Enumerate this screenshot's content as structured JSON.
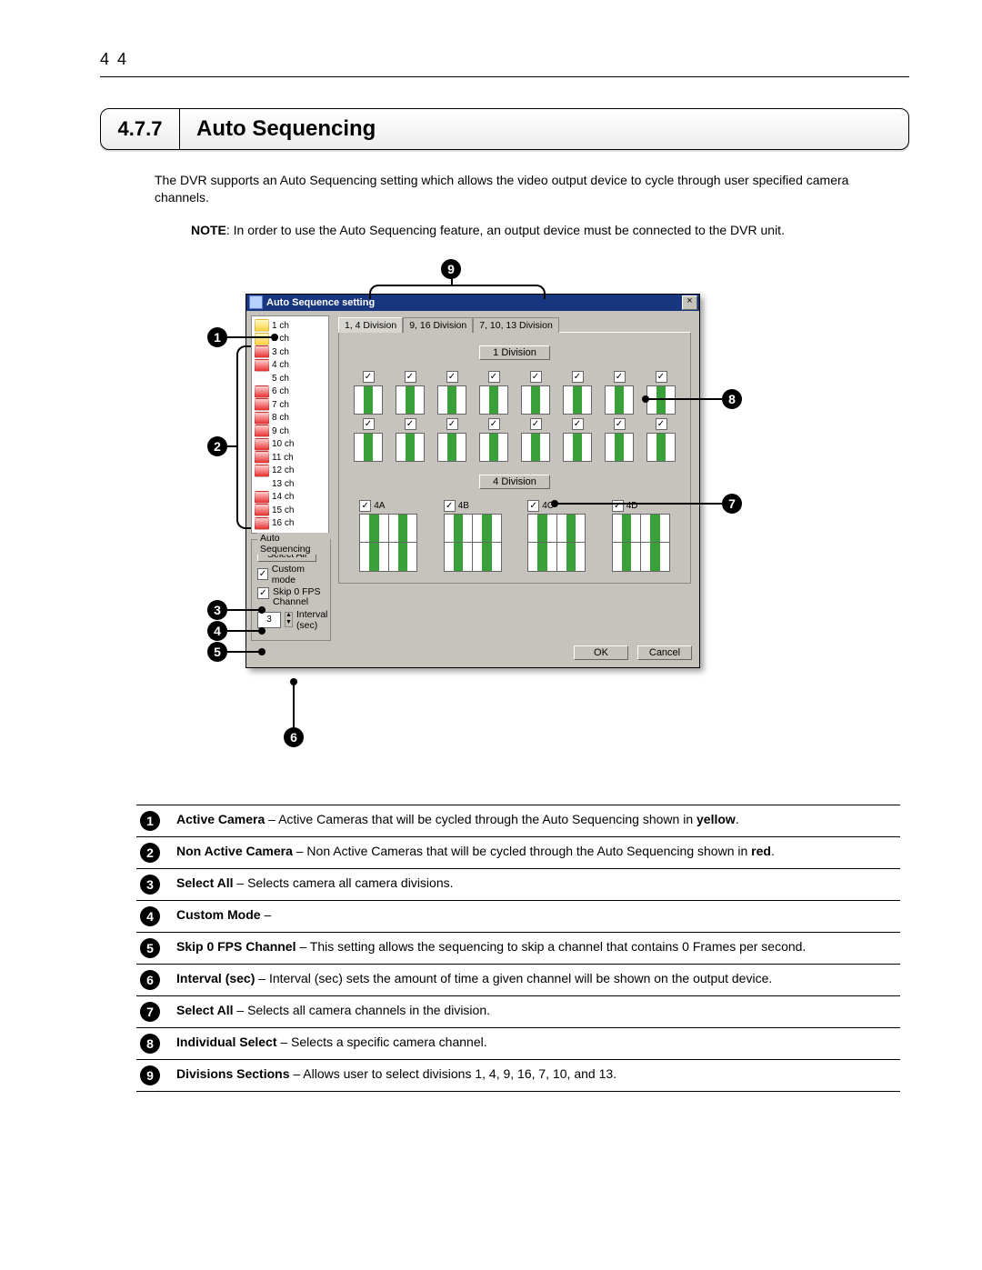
{
  "page_number": "4 4",
  "section_number": "4.7.7",
  "section_title": "Auto Sequencing",
  "intro_text": "The DVR supports an Auto Sequencing setting which allows the video output device to cycle through user specified camera channels.",
  "note_prefix": "NOTE",
  "note_text": ": In order to use the Auto Sequencing feature, an output device must be connected to the DVR unit.",
  "callouts": {
    "c1": "1",
    "c2": "2",
    "c3": "3",
    "c4": "4",
    "c5": "5",
    "c6": "6",
    "c7": "7",
    "c8": "8",
    "c9": "9"
  },
  "window": {
    "title": "Auto Sequence setting",
    "close_glyph": "×",
    "channels": [
      {
        "label": "1 ch",
        "color": "yellow"
      },
      {
        "label": "2 ch",
        "color": "yellow"
      },
      {
        "label": "3 ch",
        "color": "red"
      },
      {
        "label": "4 ch",
        "color": "red"
      },
      {
        "label": "5 ch",
        "color": "none"
      },
      {
        "label": "6 ch",
        "color": "red"
      },
      {
        "label": "7 ch",
        "color": "red"
      },
      {
        "label": "8 ch",
        "color": "red"
      },
      {
        "label": "9 ch",
        "color": "red"
      },
      {
        "label": "10 ch",
        "color": "red"
      },
      {
        "label": "11 ch",
        "color": "red"
      },
      {
        "label": "12 ch",
        "color": "red"
      },
      {
        "label": "13 ch",
        "color": "none"
      },
      {
        "label": "14 ch",
        "color": "red"
      },
      {
        "label": "15 ch",
        "color": "red"
      },
      {
        "label": "16 ch",
        "color": "red"
      }
    ],
    "tabs": [
      {
        "label": "1, 4 Division",
        "active": true
      },
      {
        "label": "9, 16 Division",
        "active": false
      },
      {
        "label": "7, 10, 13 Division",
        "active": false
      }
    ],
    "btn_1division": "1 Division",
    "btn_4division": "4 Division",
    "four_labels": [
      "4A",
      "4B",
      "4C",
      "4D"
    ],
    "group_title": "Auto Sequencing",
    "select_all_btn": "Select All",
    "custom_mode_label": "Custom mode",
    "skip0_label_line1": "Skip 0 FPS",
    "skip0_label_line2": "Channel",
    "interval_value": "3",
    "interval_label": "Interval (sec)",
    "ok_label": "OK",
    "cancel_label": "Cancel"
  },
  "legend": [
    {
      "num": "1",
      "term": "Active Camera",
      "desc": " – Active Cameras that will be cycled through the Auto Sequencing shown in ",
      "extra_bold": "yellow",
      "extra_tail": "."
    },
    {
      "num": "2",
      "term": "Non Active Camera",
      "desc": " – Non Active Cameras that will be cycled through the Auto Sequencing shown in ",
      "extra_bold": "red",
      "extra_tail": "."
    },
    {
      "num": "3",
      "term": "Select All",
      "desc": " – Selects camera all camera divisions."
    },
    {
      "num": "4",
      "term": "Custom Mode",
      "desc": " – "
    },
    {
      "num": "5",
      "term": "Skip 0 FPS Channel",
      "desc": " – This setting allows the sequencing to skip a channel that contains 0 Frames per second."
    },
    {
      "num": "6",
      "term": "Interval (sec)",
      "desc": " – Interval (sec) sets the amount of time a given channel will be shown on the output device."
    },
    {
      "num": "7",
      "term": "Select All",
      "desc": " – Selects all camera channels in the division."
    },
    {
      "num": "8",
      "term": "Individual Select",
      "desc": " – Selects a specific camera channel."
    },
    {
      "num": "9",
      "term": "Divisions Sections",
      "desc": " – Allows user to select divisions 1, 4, 9, 16, 7, 10, and 13."
    }
  ]
}
